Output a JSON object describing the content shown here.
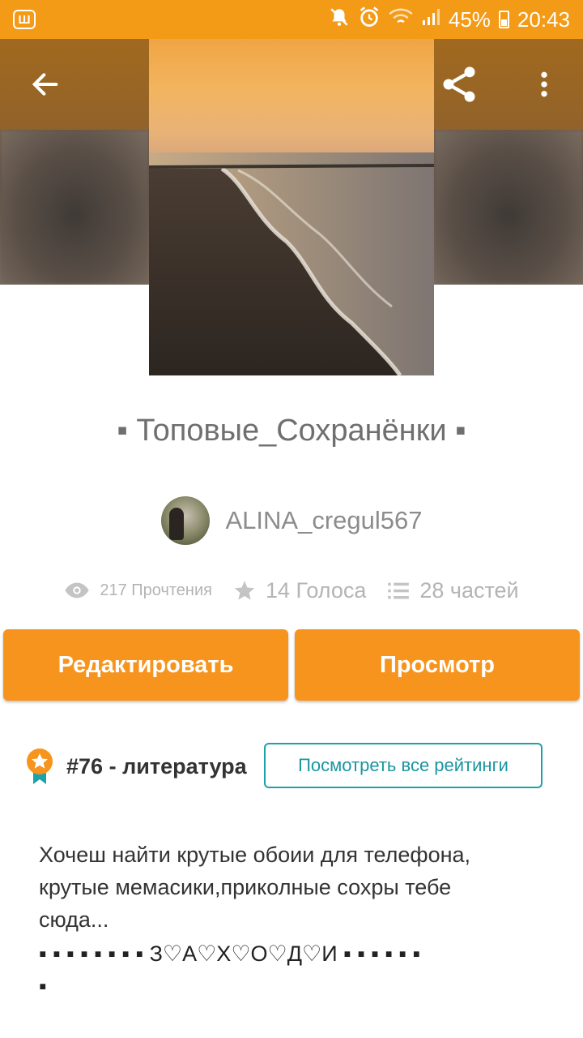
{
  "status_bar": {
    "app_icon": "Ш",
    "battery": "45%",
    "time": "20:43"
  },
  "story": {
    "title": "▪ Топовые_Сохранёнки ▪",
    "author": "ALINA_cregul567",
    "stats": {
      "reads": "217 Прочтения",
      "votes": "14 Голоса",
      "parts": "28 частей"
    }
  },
  "actions": {
    "edit_label": "Редактировать",
    "view_label": "Просмотр"
  },
  "ranking": {
    "rank": "#76",
    "separator": "-",
    "category": "литература",
    "all_ratings_label": "Посмотреть все рейтинги"
  },
  "description": {
    "line1": "Хочеш найти крутые обоии для телефона,",
    "line2": "крутые мемасики,приколные сохры тебе",
    "line3": "сюда...",
    "line4": "▪ ▪ ▪ ▪ ▪ ▪ ▪ ▪ З♡А♡Х♡О♡Д♡И ▪ ▪ ▪ ▪ ▪ ▪",
    "line5": "▪"
  },
  "colors": {
    "status_bar": "#f39a16",
    "accent": "#f7941d",
    "teal": "#1ba2ab"
  }
}
